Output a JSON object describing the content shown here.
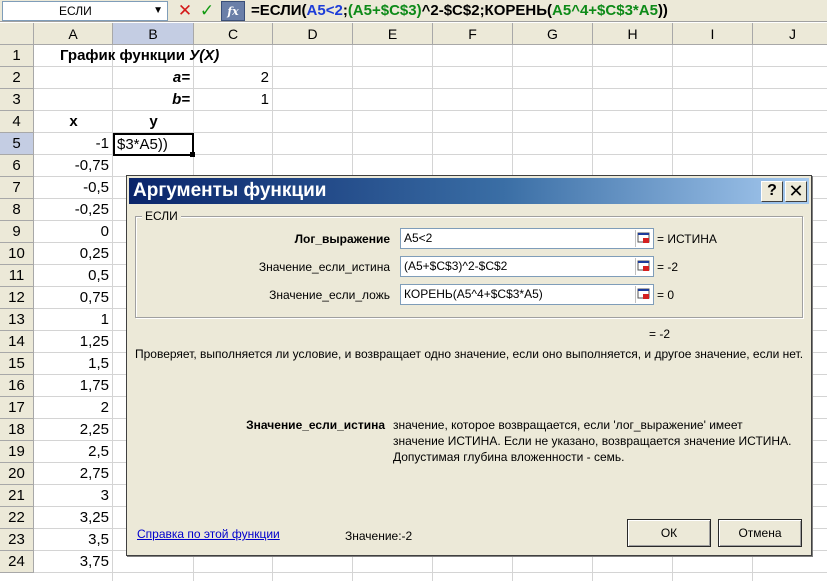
{
  "formula_bar": {
    "name_box": "ЕСЛИ",
    "name_box_arrow": "▼",
    "cancel_glyph": "✕",
    "enter_glyph": "✓",
    "fx_label": "fx",
    "formula_parts": [
      "=ЕСЛИ(",
      "А5<2",
      ";",
      "(А5+$C$3)",
      "^2-$C$2;КОРЕНЬ(",
      "А5^4+$C$3*А5",
      "))"
    ]
  },
  "columns": [
    "A",
    "B",
    "C",
    "D",
    "E",
    "F",
    "G",
    "H",
    "I",
    "J"
  ],
  "active_column": "B",
  "rows": [
    "1",
    "2",
    "3",
    "4",
    "5",
    "6",
    "7",
    "8",
    "9",
    "10",
    "11",
    "12",
    "13",
    "14",
    "15",
    "16",
    "17",
    "18",
    "19",
    "20",
    "21",
    "22",
    "23",
    "24"
  ],
  "active_row": "5",
  "sheet": {
    "title": "График функции",
    "title_func": "У(Х)",
    "a_label": "a=",
    "a_value": "2",
    "b_label": "b=",
    "b_value": "1",
    "x_header": "x",
    "y_header": "y",
    "active_cell_text": "$3*A5))",
    "x_values": [
      "-1",
      "-0,75",
      "-0,5",
      "-0,25",
      "0",
      "0,25",
      "0,5",
      "0,75",
      "1",
      "1,25",
      "1,5",
      "1,75",
      "2",
      "2,25",
      "2,5",
      "2,75",
      "3",
      "3,25",
      "3,5",
      "3,75"
    ]
  },
  "dialog": {
    "title": "Аргументы функции",
    "help_glyph": "?",
    "close_glyph": "✕",
    "group_label": "ЕСЛИ",
    "args": [
      {
        "label": "Лог_выражение",
        "value": "A5<2",
        "result": "= ИСТИНА",
        "bold": true
      },
      {
        "label": "Значение_если_истина",
        "value": "(A5+$C$3)^2-$C$2",
        "result": "= -2",
        "bold": false
      },
      {
        "label": "Значение_если_ложь",
        "value": "КОРЕНЬ(A5^4+$C$3*A5)",
        "result": "= 0",
        "bold": false
      }
    ],
    "overall_result": "= -2",
    "description": "Проверяет, выполняется ли условие, и возвращает одно значение, если оно выполняется, и другое значение, если нет.",
    "arg_help_name": "Значение_если_истина",
    "arg_help_text": "значение, которое возвращается, если 'лог_выражение' имеет значение ИСТИНА. Если не указано, возвращается значение ИСТИНА. Допустимая глубина вложенности - семь.",
    "help_link": "Справка по этой функции",
    "value_line": "Значение:-2",
    "ok_label": "ОК",
    "cancel_label": "Отмена"
  }
}
